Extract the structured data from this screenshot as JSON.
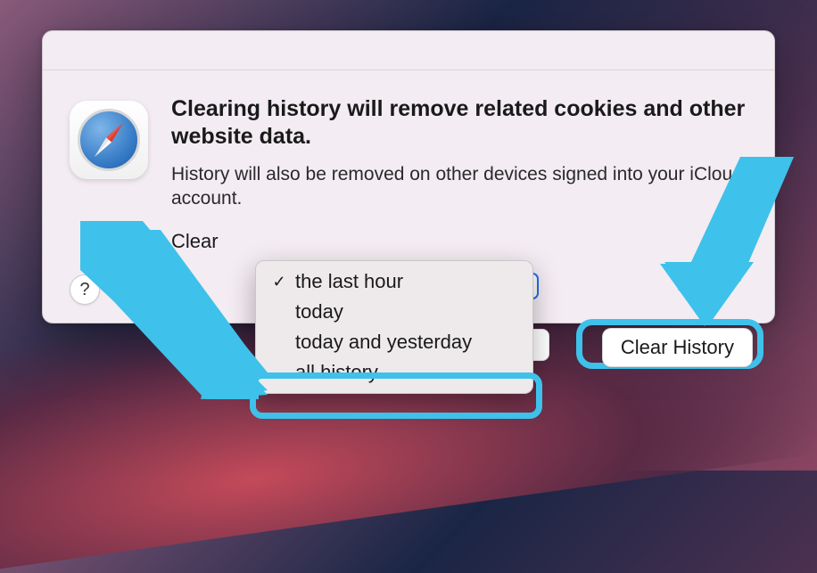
{
  "dialog": {
    "title": "Clearing history will remove related cookies and other website data.",
    "subtitle": "History will also be removed on other devices signed into your iCloud account.",
    "clear_label_prefix": "Clear",
    "help_label": "?",
    "clear_button": "Clear History"
  },
  "dropdown": {
    "selected_index": 0,
    "items": [
      {
        "label": "the last hour",
        "checked": true
      },
      {
        "label": "today",
        "checked": false
      },
      {
        "label": "today and yesterday",
        "checked": false
      },
      {
        "label": "all history",
        "checked": false
      }
    ]
  },
  "annotation": {
    "highlight_item_index": 3,
    "clear_button_highlight": true,
    "arrow_color": "#3ec1ea"
  }
}
